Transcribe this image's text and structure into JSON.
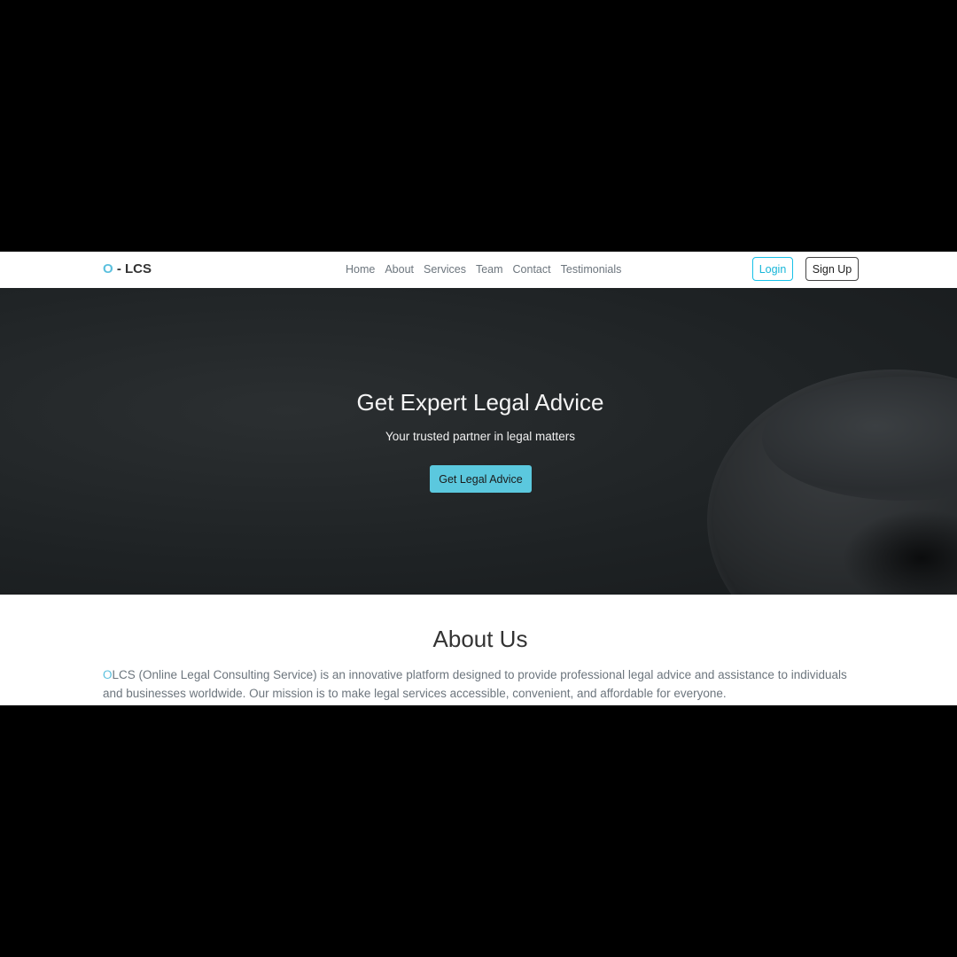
{
  "brand": {
    "accent": "O",
    "rest": " - LCS",
    "accent_color": "#5bc0de"
  },
  "nav": {
    "links": [
      "Home",
      "About",
      "Services",
      "Team",
      "Contact",
      "Testimonials"
    ],
    "login_label": "Login",
    "signup_label": "Sign Up"
  },
  "hero": {
    "title": "Get Expert Legal Advice",
    "subtitle": "Your trusted partner in legal matters",
    "cta_label": "Get Legal Advice",
    "cta_color": "#5bc8de"
  },
  "about": {
    "title": "About Us",
    "text_accent": "O",
    "text_rest": "LCS (Online Legal Consulting Service) is an innovative platform designed to provide professional legal advice and assistance to individuals and businesses worldwide. Our mission is to make legal services accessible, convenient, and affordable for everyone."
  }
}
